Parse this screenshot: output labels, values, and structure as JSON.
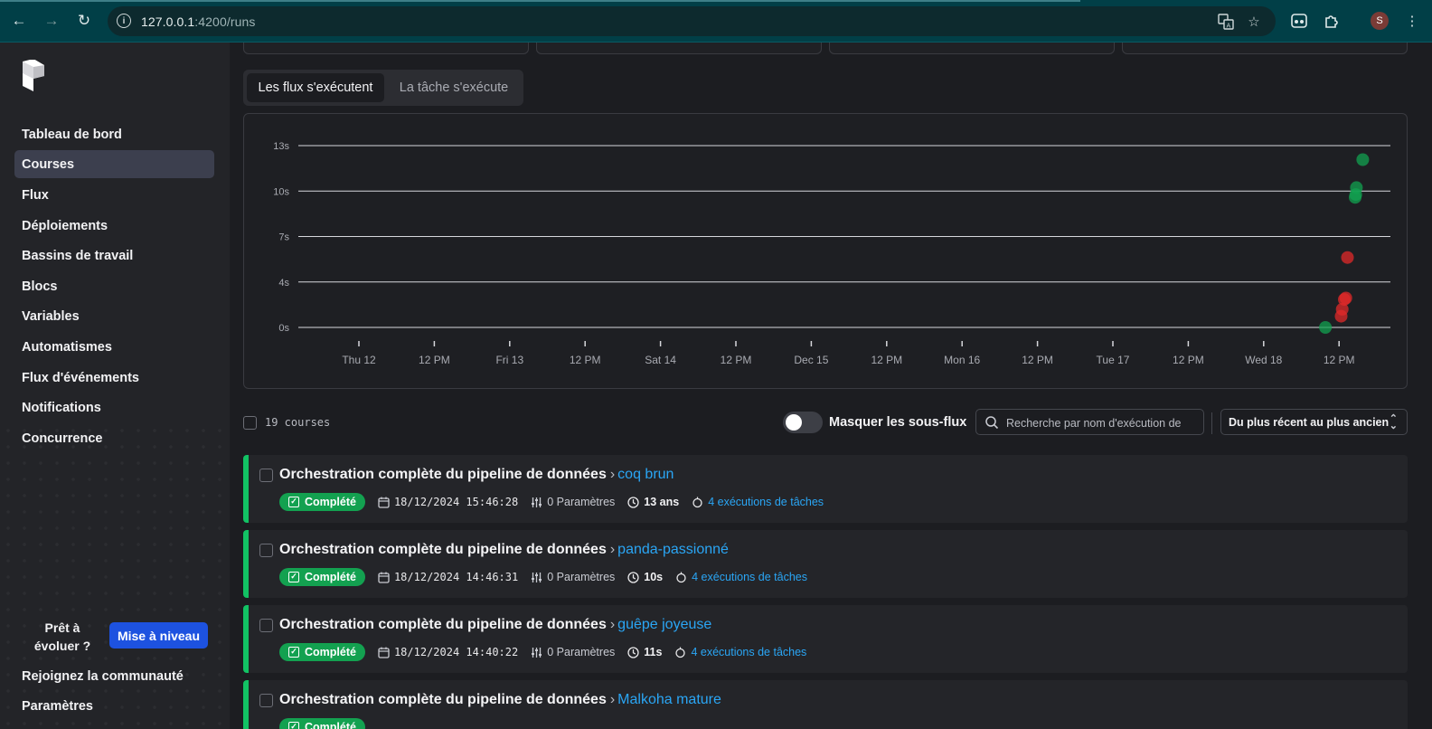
{
  "browser": {
    "url_host": "127.0.0.1",
    "url_path": ":4200/runs",
    "profile_initial": "S"
  },
  "sidebar": {
    "items": [
      {
        "label": "Tableau de bord",
        "active": false
      },
      {
        "label": "Courses",
        "active": true
      },
      {
        "label": "Flux",
        "active": false
      },
      {
        "label": "Déploiements",
        "active": false
      },
      {
        "label": "Bassins de travail",
        "active": false
      },
      {
        "label": "Blocs",
        "active": false
      },
      {
        "label": "Variables",
        "active": false
      },
      {
        "label": "Automatismes",
        "active": false
      },
      {
        "label": "Flux d'événements",
        "active": false
      },
      {
        "label": "Notifications",
        "active": false
      },
      {
        "label": "Concurrence",
        "active": false
      }
    ],
    "upgrade_prompt": "Prêt à évoluer ?",
    "upgrade_button": "Mise à niveau",
    "community": "Rejoignez la communauté",
    "settings": "Paramètres"
  },
  "tabs": {
    "flows": "Les flux s'exécutent",
    "tasks": "La tâche s'exécute"
  },
  "chart_data": {
    "type": "scatter",
    "title": "",
    "xlabel": "",
    "ylabel": "",
    "y_ticks": [
      "13s",
      "10s",
      "7s",
      "4s",
      "0s"
    ],
    "x_ticks": [
      "Thu 12",
      "12 PM",
      "Fri 13",
      "12 PM",
      "Sat 14",
      "12 PM",
      "Dec 15",
      "12 PM",
      "Mon 16",
      "12 PM",
      "Tue 17",
      "12 PM",
      "Wed 18",
      "12 PM"
    ],
    "ylim": [
      0,
      13
    ],
    "grid": true,
    "series": [
      {
        "color": "#12a150",
        "points": [
          {
            "x": "2024-12-18 15:46",
            "y": 12
          },
          {
            "x": "2024-12-18 14:46",
            "y": 10
          },
          {
            "x": "2024-12-18 14:40",
            "y": 9.5
          },
          {
            "x": "2024-12-18 14:34",
            "y": 9.3
          },
          {
            "x": "2024-12-18 09:50",
            "y": 0
          }
        ]
      },
      {
        "color": "#e02a2a",
        "points": [
          {
            "x": "2024-12-18 13:20",
            "y": 5
          },
          {
            "x": "2024-12-18 13:05",
            "y": 2.1
          },
          {
            "x": "2024-12-18 12:50",
            "y": 2
          },
          {
            "x": "2024-12-18 12:30",
            "y": 1.3
          },
          {
            "x": "2024-12-18 12:20",
            "y": 0.8
          }
        ]
      }
    ]
  },
  "toolbar": {
    "count_label": "19 courses",
    "hide_subflows": "Masquer les sous-flux",
    "search_placeholder": "Recherche par nom d'exécution de",
    "sort_label": "Du plus récent au plus ancien"
  },
  "runs": [
    {
      "flow": "Orchestration complète du pipeline de données",
      "name": "coq brun",
      "status": "Complété",
      "date": "18/12/2024 15:46:28",
      "params": "0 Paramètres",
      "duration": "13 ans",
      "tasks": "4 exécutions de tâches"
    },
    {
      "flow": "Orchestration complète du pipeline de données",
      "name": "panda-passionné",
      "status": "Complété",
      "date": "18/12/2024 14:46:31",
      "params": "0 Paramètres",
      "duration": "10s",
      "tasks": "4 exécutions de tâches"
    },
    {
      "flow": "Orchestration complète du pipeline de données",
      "name": "guêpe joyeuse",
      "status": "Complété",
      "date": "18/12/2024 14:40:22",
      "params": "0 Paramètres",
      "duration": "11s",
      "tasks": "4 exécutions de tâches"
    },
    {
      "flow": "Orchestration complète du pipeline de données",
      "name": "Malkoha mature",
      "status": "Complété",
      "date": "",
      "params": "",
      "duration": "",
      "tasks": ""
    }
  ]
}
